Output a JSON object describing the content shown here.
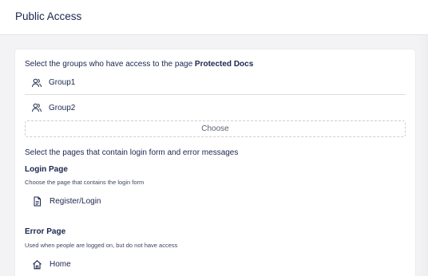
{
  "header": {
    "title": "Public Access"
  },
  "groups_section": {
    "instruction_prefix": "Select the groups who have access to the page",
    "page_name": "Protected Docs",
    "groups": [
      {
        "label": "Group1",
        "icon": "users-icon"
      },
      {
        "label": "Group2",
        "icon": "users-icon"
      }
    ],
    "choose_label": "Choose"
  },
  "pages_section": {
    "instruction": "Select the pages that contain login form and error messages",
    "login": {
      "title": "Login Page",
      "description": "Choose the page that contains the login form",
      "page_label": "Register/Login",
      "icon": "document-icon"
    },
    "error": {
      "title": "Error Page",
      "description": "Used when people are logged on, but do not have access",
      "page_label": "Home",
      "icon": "home-icon"
    }
  },
  "colors": {
    "text": "#1b264f",
    "background": "#f3f3f5",
    "panel": "#ffffff"
  }
}
